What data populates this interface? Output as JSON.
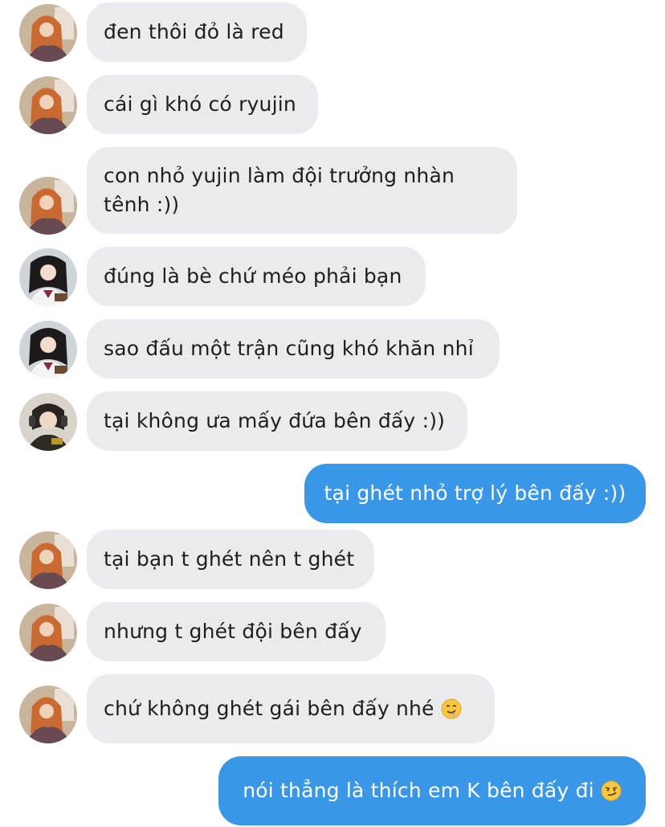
{
  "conversation": {
    "messages": [
      {
        "text": "đen thôi đỏ là red",
        "sender": "received",
        "avatar": "avatar-girl-orange-hair"
      },
      {
        "text": "cái gì khó có ryujin",
        "sender": "received",
        "avatar": "avatar-girl-orange-hair"
      },
      {
        "text": "con nhỏ yujin làm đội trưởng nhàn tênh :))",
        "sender": "received",
        "avatar": "avatar-girl-orange-hair"
      },
      {
        "text": "đúng là bè chứ méo phải bạn",
        "sender": "received",
        "avatar": "avatar-girl-dark-hair"
      },
      {
        "text": "sao đấu một trận cũng khó khăn nhỉ",
        "sender": "received",
        "avatar": "avatar-girl-dark-hair"
      },
      {
        "text": "tại không ưa mấy đứa bên đấy :))",
        "sender": "received",
        "avatar": "avatar-girl-headphones"
      },
      {
        "text": "tại ghét nhỏ trợ lý bên đấy :))",
        "sender": "sent"
      },
      {
        "text": "tại bạn t ghét nên t ghét",
        "sender": "received",
        "avatar": "avatar-girl-orange-hair"
      },
      {
        "text": "nhưng t ghét đội bên đấy",
        "sender": "received",
        "avatar": "avatar-girl-orange-hair"
      },
      {
        "text": "chứ không ghét gái bên đấy nhé",
        "sender": "received",
        "avatar": "avatar-girl-orange-hair",
        "emoji": "drooling-face-emoji"
      },
      {
        "text": "nói thẳng là thích em K bên đấy đi",
        "sender": "sent",
        "emoji": "smirking-face-emoji"
      }
    ]
  },
  "colors": {
    "received_bubble": "#e9ebee",
    "sent_bubble": "#3a96e6",
    "received_text": "#1c1e21",
    "sent_text": "#ffffff"
  }
}
